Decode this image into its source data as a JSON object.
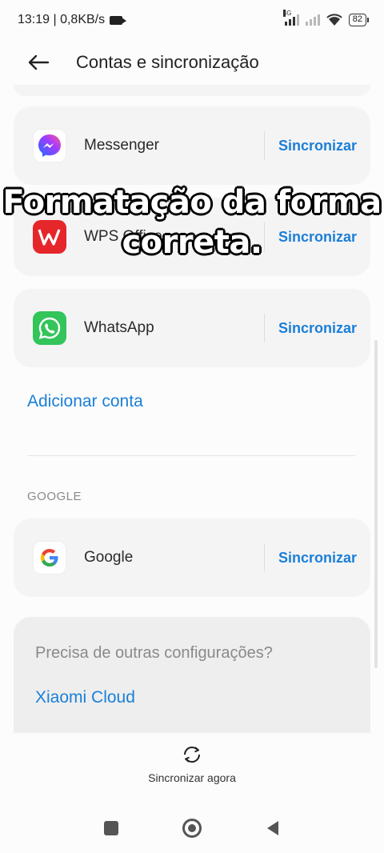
{
  "status_bar": {
    "time_and_speed": "13:19 | 0,8KB/s",
    "network_tag": "4G",
    "battery": "82"
  },
  "header": {
    "title": "Contas e sincronização"
  },
  "accounts": [
    {
      "label": "Messenger",
      "action": "Sincronizar",
      "icon": "messenger-icon"
    },
    {
      "label": "WPS Office",
      "action": "Sincronizar",
      "icon": "wps-office-icon"
    },
    {
      "label": "WhatsApp",
      "action": "Sincronizar",
      "icon": "whatsapp-icon"
    }
  ],
  "add_account": "Adicionar conta",
  "google_section": {
    "heading": "GOOGLE",
    "label": "Google",
    "action": "Sincronizar",
    "icon": "google-icon"
  },
  "other_settings": {
    "question": "Precisa de outras configurações?",
    "link": "Xiaomi Cloud"
  },
  "sync_now": {
    "label": "Sincronizar agora",
    "icon": "sync-icon"
  },
  "overlay_caption": {
    "line1": "Formatação da forma",
    "line2": "correta."
  },
  "colors": {
    "accent": "#1a7fd8",
    "card_bg": "#f4f4f4",
    "whatsapp": "#33c45a",
    "wps": "#e5262a"
  }
}
